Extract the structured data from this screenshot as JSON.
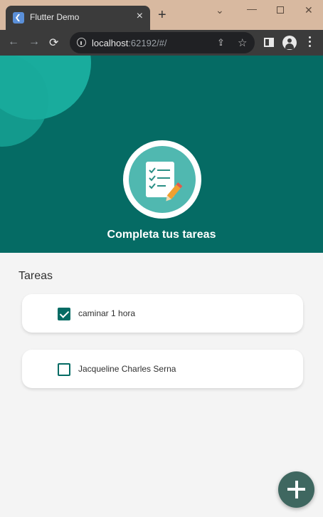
{
  "browser": {
    "tab_title": "Flutter Demo",
    "close_glyph": "×",
    "newtab_glyph": "+",
    "url_host": "localhost",
    "url_rest": ":62192/#/",
    "icons": [
      "flutter-favicon",
      "back-icon",
      "forward-icon",
      "reload-icon",
      "info-icon",
      "share-icon",
      "star-icon",
      "side-panel-icon",
      "profile-icon",
      "menu-icon"
    ]
  },
  "app": {
    "header_title": "Completa tus tareas",
    "section_title": "Tareas",
    "tasks": [
      {
        "label": "caminar 1 hora",
        "done": true
      },
      {
        "label": "Jacqueline Charles Serna",
        "done": false
      }
    ],
    "fab_icon": "add-icon",
    "colors": {
      "primary": "#056b64",
      "accent": "#1db7a7",
      "fab": "#3f6760",
      "background": "#f4f4f4"
    }
  }
}
